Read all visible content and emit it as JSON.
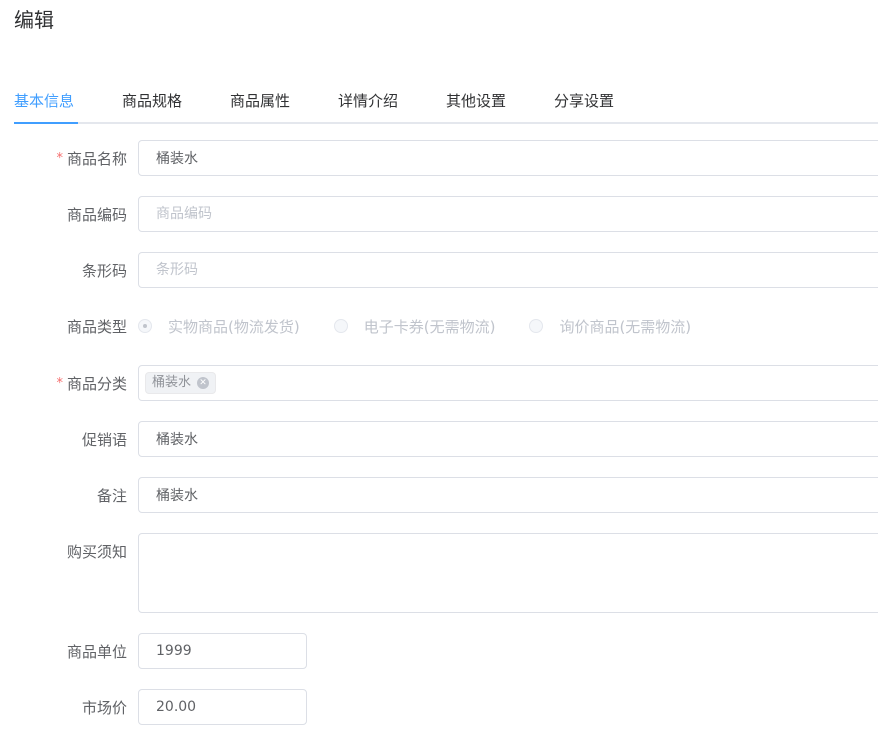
{
  "page": {
    "title": "编辑"
  },
  "tabs": [
    {
      "label": "基本信息",
      "active": true
    },
    {
      "label": "商品规格",
      "active": false
    },
    {
      "label": "商品属性",
      "active": false
    },
    {
      "label": "详情介绍",
      "active": false
    },
    {
      "label": "其他设置",
      "active": false
    },
    {
      "label": "分享设置",
      "active": false
    }
  ],
  "form": {
    "name": {
      "label": "商品名称",
      "required": true,
      "value": "桶装水",
      "placeholder": ""
    },
    "code": {
      "label": "商品编码",
      "required": false,
      "value": "",
      "placeholder": "商品编码"
    },
    "barcode": {
      "label": "条形码",
      "required": false,
      "value": "",
      "placeholder": "条形码"
    },
    "type": {
      "label": "商品类型",
      "options": [
        {
          "label": "实物商品(物流发货)",
          "checked": true
        },
        {
          "label": "电子卡券(无需物流)",
          "checked": false
        },
        {
          "label": "询价商品(无需物流)",
          "checked": false
        }
      ],
      "disabled": true
    },
    "category": {
      "label": "商品分类",
      "required": true,
      "tags": [
        "桶装水"
      ]
    },
    "promo": {
      "label": "促销语",
      "required": false,
      "value": "桶装水"
    },
    "remark": {
      "label": "备注",
      "required": false,
      "value": "桶装水"
    },
    "notice": {
      "label": "购买须知",
      "required": false,
      "value": ""
    },
    "unit": {
      "label": "商品单位",
      "required": false,
      "value": "1999"
    },
    "market_price": {
      "label": "市场价",
      "required": false,
      "value": "20.00"
    }
  },
  "colors": {
    "accent": "#409eff",
    "required": "#f56c6c",
    "border": "#dcdfe6",
    "placeholder": "#c0c4cc"
  }
}
